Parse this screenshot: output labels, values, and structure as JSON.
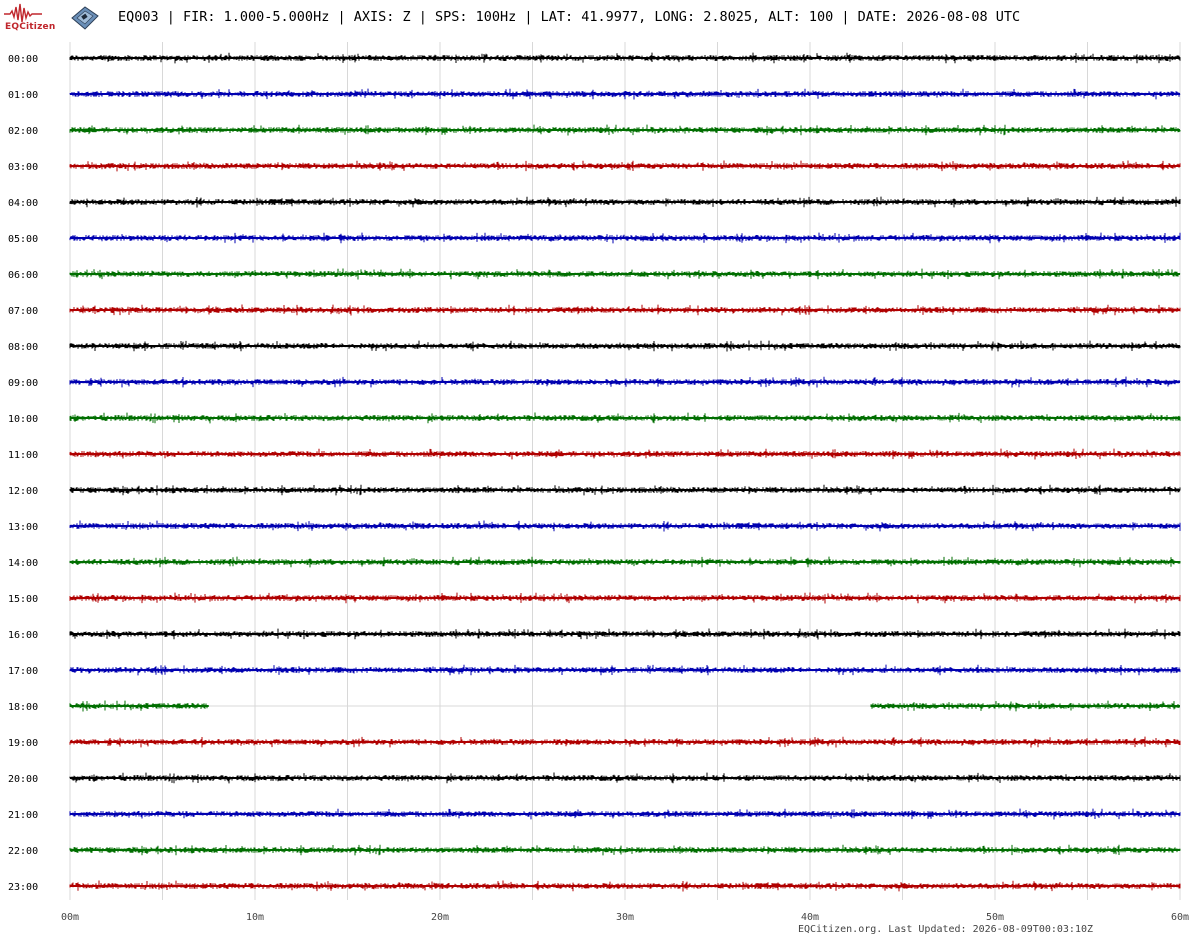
{
  "header": {
    "logo_text": "EQCitizen",
    "title": "EQ003 | FIR: 1.000-5.000Hz | AXIS: Z | SPS: 100Hz | LAT: 41.9977, LONG: 2.8025, ALT: 100 | DATE: 2026-08-08 UTC"
  },
  "footer": {
    "text": "EQCitizen.org. Last Updated: 2026-08-09T00:03:10Z"
  },
  "colors": {
    "cycle": [
      "#000000",
      "#0000b0",
      "#006e00",
      "#b00000"
    ],
    "grid": "#d8d8d8",
    "logo": "#c0272d"
  },
  "chart_data": {
    "type": "line",
    "title": "EQ003 | FIR: 1.000-5.000Hz | AXIS: Z | SPS: 100Hz | LAT: 41.9977, LONG: 2.8025, ALT: 100 | DATE: 2026-08-08 UTC",
    "description": "24-hour helicorder; one trace per hour, x = minutes past the hour",
    "x_ticks": [
      "00m",
      "10m",
      "20m",
      "30m",
      "40m",
      "50m",
      "60m"
    ],
    "xlim": [
      0,
      60
    ],
    "grid": true,
    "series": [
      {
        "name": "00:00",
        "segments": [
          [
            0,
            60
          ]
        ]
      },
      {
        "name": "01:00",
        "segments": [
          [
            0,
            60
          ]
        ]
      },
      {
        "name": "02:00",
        "segments": [
          [
            0,
            60
          ]
        ]
      },
      {
        "name": "03:00",
        "segments": [
          [
            0,
            60
          ]
        ]
      },
      {
        "name": "04:00",
        "segments": [
          [
            0,
            60
          ]
        ]
      },
      {
        "name": "05:00",
        "segments": [
          [
            0,
            60
          ]
        ]
      },
      {
        "name": "06:00",
        "segments": [
          [
            0,
            60
          ]
        ]
      },
      {
        "name": "07:00",
        "segments": [
          [
            0,
            60
          ]
        ]
      },
      {
        "name": "08:00",
        "segments": [
          [
            0,
            60
          ]
        ]
      },
      {
        "name": "09:00",
        "segments": [
          [
            0,
            60
          ]
        ]
      },
      {
        "name": "10:00",
        "segments": [
          [
            0,
            60
          ]
        ]
      },
      {
        "name": "11:00",
        "segments": [
          [
            0,
            60
          ]
        ]
      },
      {
        "name": "12:00",
        "segments": [
          [
            0,
            60
          ]
        ]
      },
      {
        "name": "13:00",
        "segments": [
          [
            0,
            60
          ]
        ]
      },
      {
        "name": "14:00",
        "segments": [
          [
            0,
            60
          ]
        ]
      },
      {
        "name": "15:00",
        "segments": [
          [
            0,
            60
          ]
        ]
      },
      {
        "name": "16:00",
        "segments": [
          [
            0,
            60
          ]
        ]
      },
      {
        "name": "17:00",
        "segments": [
          [
            0,
            60
          ]
        ]
      },
      {
        "name": "18:00",
        "segments": [
          [
            0,
            7.5
          ],
          [
            43.3,
            60
          ]
        ]
      },
      {
        "name": "19:00",
        "segments": [
          [
            0,
            60
          ]
        ]
      },
      {
        "name": "20:00",
        "segments": [
          [
            0,
            60
          ]
        ]
      },
      {
        "name": "21:00",
        "segments": [
          [
            0,
            60
          ]
        ]
      },
      {
        "name": "22:00",
        "segments": [
          [
            0,
            60
          ]
        ]
      },
      {
        "name": "23:00",
        "segments": [
          [
            0,
            60
          ]
        ]
      }
    ]
  }
}
